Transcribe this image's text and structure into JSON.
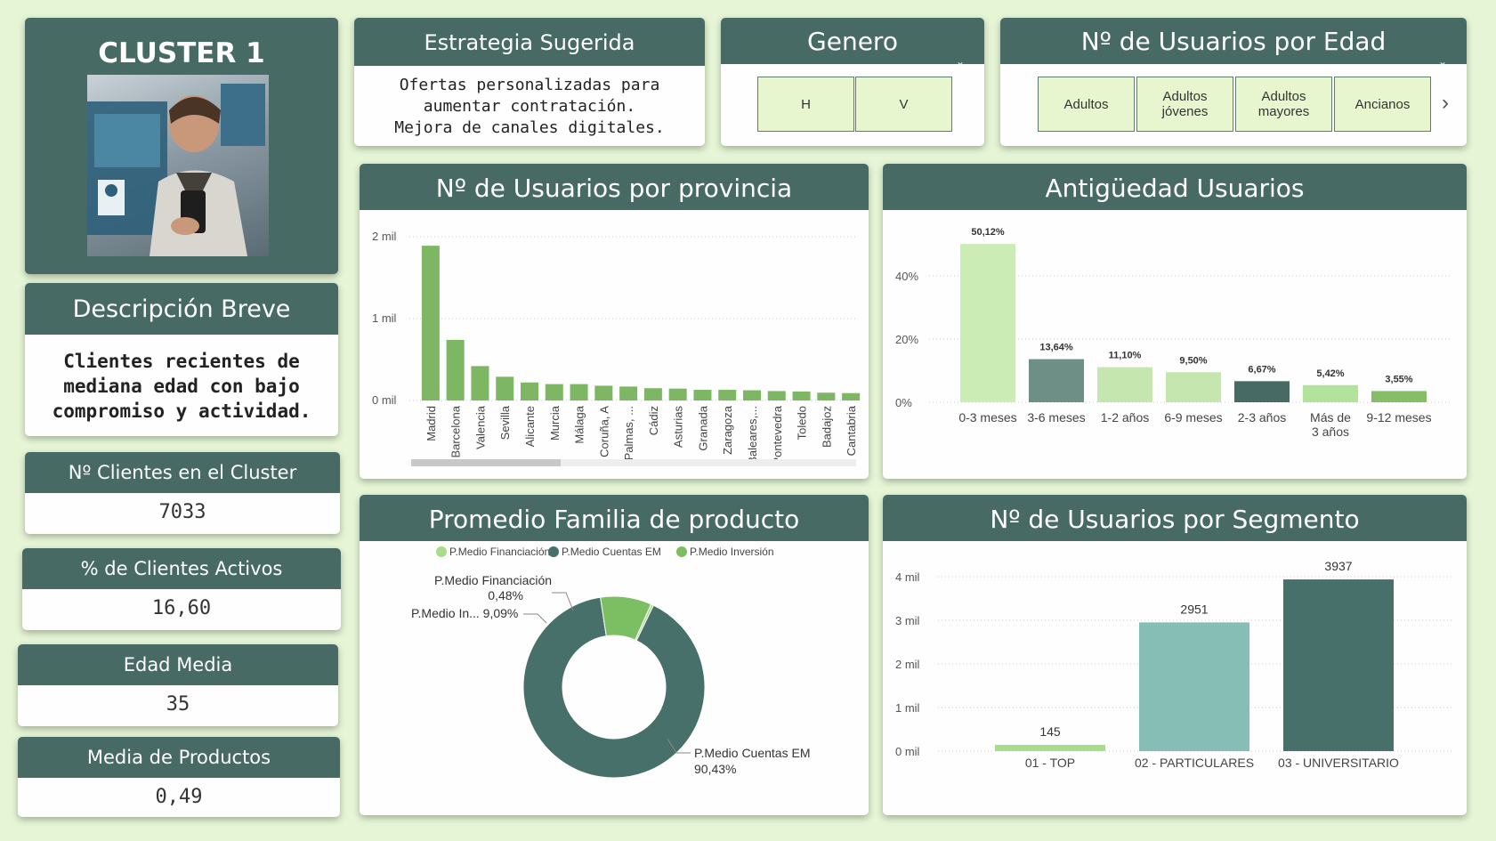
{
  "cluster": {
    "title": "CLUSTER 1"
  },
  "strategy": {
    "title": "Estrategia Sugerida",
    "lines": [
      "Ofertas personalizadas para",
      "aumentar contratación.",
      "Mejora de canales digitales."
    ]
  },
  "genero": {
    "title": "Genero",
    "options": [
      "H",
      "V"
    ]
  },
  "edad_slicer": {
    "title": "Nº de Usuarios por Edad",
    "options": [
      "Adultos",
      "Adultos jóvenes",
      "Adultos mayores",
      "Ancianos"
    ]
  },
  "description": {
    "title": "Descripción Breve",
    "lines": [
      "Clientes recientes de",
      "mediana edad con bajo",
      "compromiso y actividad."
    ]
  },
  "kpis": [
    {
      "label": "Nº Clientes en el Cluster",
      "value": "7033"
    },
    {
      "label": "% de Clientes Activos",
      "value": "16,60"
    },
    {
      "label": "Edad Media",
      "value": "35"
    },
    {
      "label": "Media de Productos",
      "value": "0,49"
    }
  ],
  "chart_data": [
    {
      "type": "bar",
      "title": "Nº de Usuarios por provincia",
      "categories": [
        "Madrid",
        "Barcelona",
        "Valencia",
        "Sevilla",
        "Alicante",
        "Murcia",
        "Málaga",
        "Coruña, A",
        "Palmas, ...",
        "Cádiz",
        "Asturias",
        "Granada",
        "Zaragoza",
        "Baleares,...",
        "Pontevedra",
        "Toledo",
        "Badajoz",
        "Cantabria"
      ],
      "values": [
        1890,
        740,
        420,
        290,
        220,
        200,
        200,
        180,
        170,
        150,
        145,
        130,
        130,
        125,
        115,
        110,
        95,
        90
      ],
      "ylim": [
        0,
        2000
      ],
      "yticks": [
        "2 mil",
        "1 mil",
        "0 mil"
      ],
      "color": "#7db764"
    },
    {
      "type": "bar",
      "title": "Antigüedad Usuarios",
      "categories": [
        "0-3 meses",
        "3-6 meses",
        "1-2 años",
        "6-9 meses",
        "2-3 años",
        "Más de 3 años",
        "9-12 meses"
      ],
      "values": [
        50.12,
        13.64,
        11.1,
        9.5,
        6.67,
        5.42,
        3.55
      ],
      "labels": [
        "50,12%",
        "13,64%",
        "11,10%",
        "9,50%",
        "6,67%",
        "5,42%",
        "3,55%"
      ],
      "colors": [
        "#ccecb6",
        "#6e8f86",
        "#c6e6b0",
        "#c6e6b0",
        "#476a64",
        "#b2e39a",
        "#85be66"
      ],
      "ylim": [
        0,
        55
      ],
      "yticks": [
        "40%",
        "20%",
        "0%"
      ]
    },
    {
      "type": "pie",
      "title": "Promedio Familia de producto",
      "legend": [
        "P.Medio Financiación",
        "P.Medio Cuentas EM",
        "P.Medio Inversión"
      ],
      "slices": [
        {
          "name": "P.Medio Financiación",
          "value": 0.48,
          "label": "0,48%",
          "color": "#a8dd8c"
        },
        {
          "name": "P.Medio Cuentas EM",
          "value": 90.43,
          "label": "90,43%",
          "color": "#47706a"
        },
        {
          "name": "P.Medio Inversión",
          "value": 9.09,
          "label": "9,09%",
          "color": "#7cbe62"
        }
      ],
      "callouts": {
        "fin": "P.Medio Financiación",
        "fin_val": "0,48%",
        "inv": "P.Medio In... 9,09%",
        "cuentas": "P.Medio Cuentas EM",
        "cuentas_val": "90,43%"
      }
    },
    {
      "type": "bar",
      "title": "Nº de Usuarios por Segmento",
      "categories": [
        "01 - TOP",
        "02 - PARTICULARES",
        "03 - UNIVERSITARIO"
      ],
      "values": [
        145,
        2951,
        3937
      ],
      "labels": [
        "145",
        "2951",
        "3937"
      ],
      "colors": [
        "#a8dd8c",
        "#86bdb4",
        "#47706a"
      ],
      "ylim": [
        0,
        4000
      ],
      "yticks": [
        "4 mil",
        "3 mil",
        "2 mil",
        "1 mil",
        "0 mil"
      ]
    }
  ]
}
